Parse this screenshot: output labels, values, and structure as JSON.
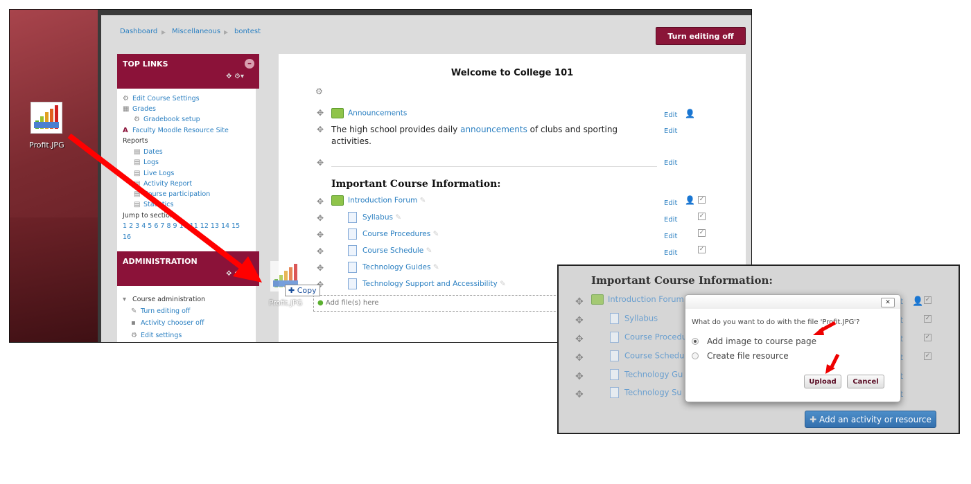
{
  "desktop": {
    "file_icon_label": "Profit.JPG",
    "drag_label": "Profit.JPG",
    "copy_label": "Copy",
    "icon_logo_text": "PROFIT"
  },
  "breadcrumb": [
    "Dashboard",
    "Miscellaneous",
    "bontest"
  ],
  "header": {
    "turn_editing_off": "Turn editing off"
  },
  "top_links": {
    "title": "TOP LINKS",
    "items": [
      "Edit Course Settings",
      "Grades",
      "Gradebook setup",
      "Faculty Moodle Resource Site"
    ],
    "reports_label": "Reports",
    "reports": [
      "Dates",
      "Logs",
      "Live Logs",
      "Activity Report",
      "Course participation",
      "Statistics"
    ],
    "jump_label": "Jump to section:",
    "sections_line1": "1 2 3 4 5 6 7 8 9 10 11 12 13 14 15",
    "sections_line2": "16"
  },
  "administration": {
    "title": "ADMINISTRATION",
    "course_admin": "Course administration",
    "items": [
      "Turn editing off",
      "Activity chooser off",
      "Edit settings"
    ]
  },
  "main": {
    "title": "Welcome to College 101",
    "announcements": "Announcements",
    "desc_before": "The high school provides daily ",
    "desc_link": "announcements",
    "desc_after": " of clubs and sporting activities.",
    "section_title": "Important Course Information:",
    "activities": [
      "Introduction Forum",
      "Syllabus",
      "Course Procedures",
      "Course Schedule",
      "Technology Guides",
      "Technology Support and Accessibility"
    ],
    "edit_label": "Edit",
    "add_files": "Add file(s) here"
  },
  "inset": {
    "section_title": "Important Course Information:",
    "activities": [
      "Introduction Forum",
      "Syllabus",
      "Course Procedu",
      "Course Schedu",
      "Technology Gu",
      "Technology Su"
    ],
    "edit_suffix": "dit",
    "add_activity": "Add an activity or resource"
  },
  "dialog": {
    "question": "What do you want to do with the file 'Profit.JPG'?",
    "options": [
      "Add image to course page",
      "Create file resource"
    ],
    "selected": 0,
    "upload": "Upload",
    "cancel": "Cancel",
    "close": "✕"
  },
  "colors": {
    "brand": "#8b1239",
    "link": "#2a7fc1",
    "annotation_arrow": "#ff0000"
  }
}
